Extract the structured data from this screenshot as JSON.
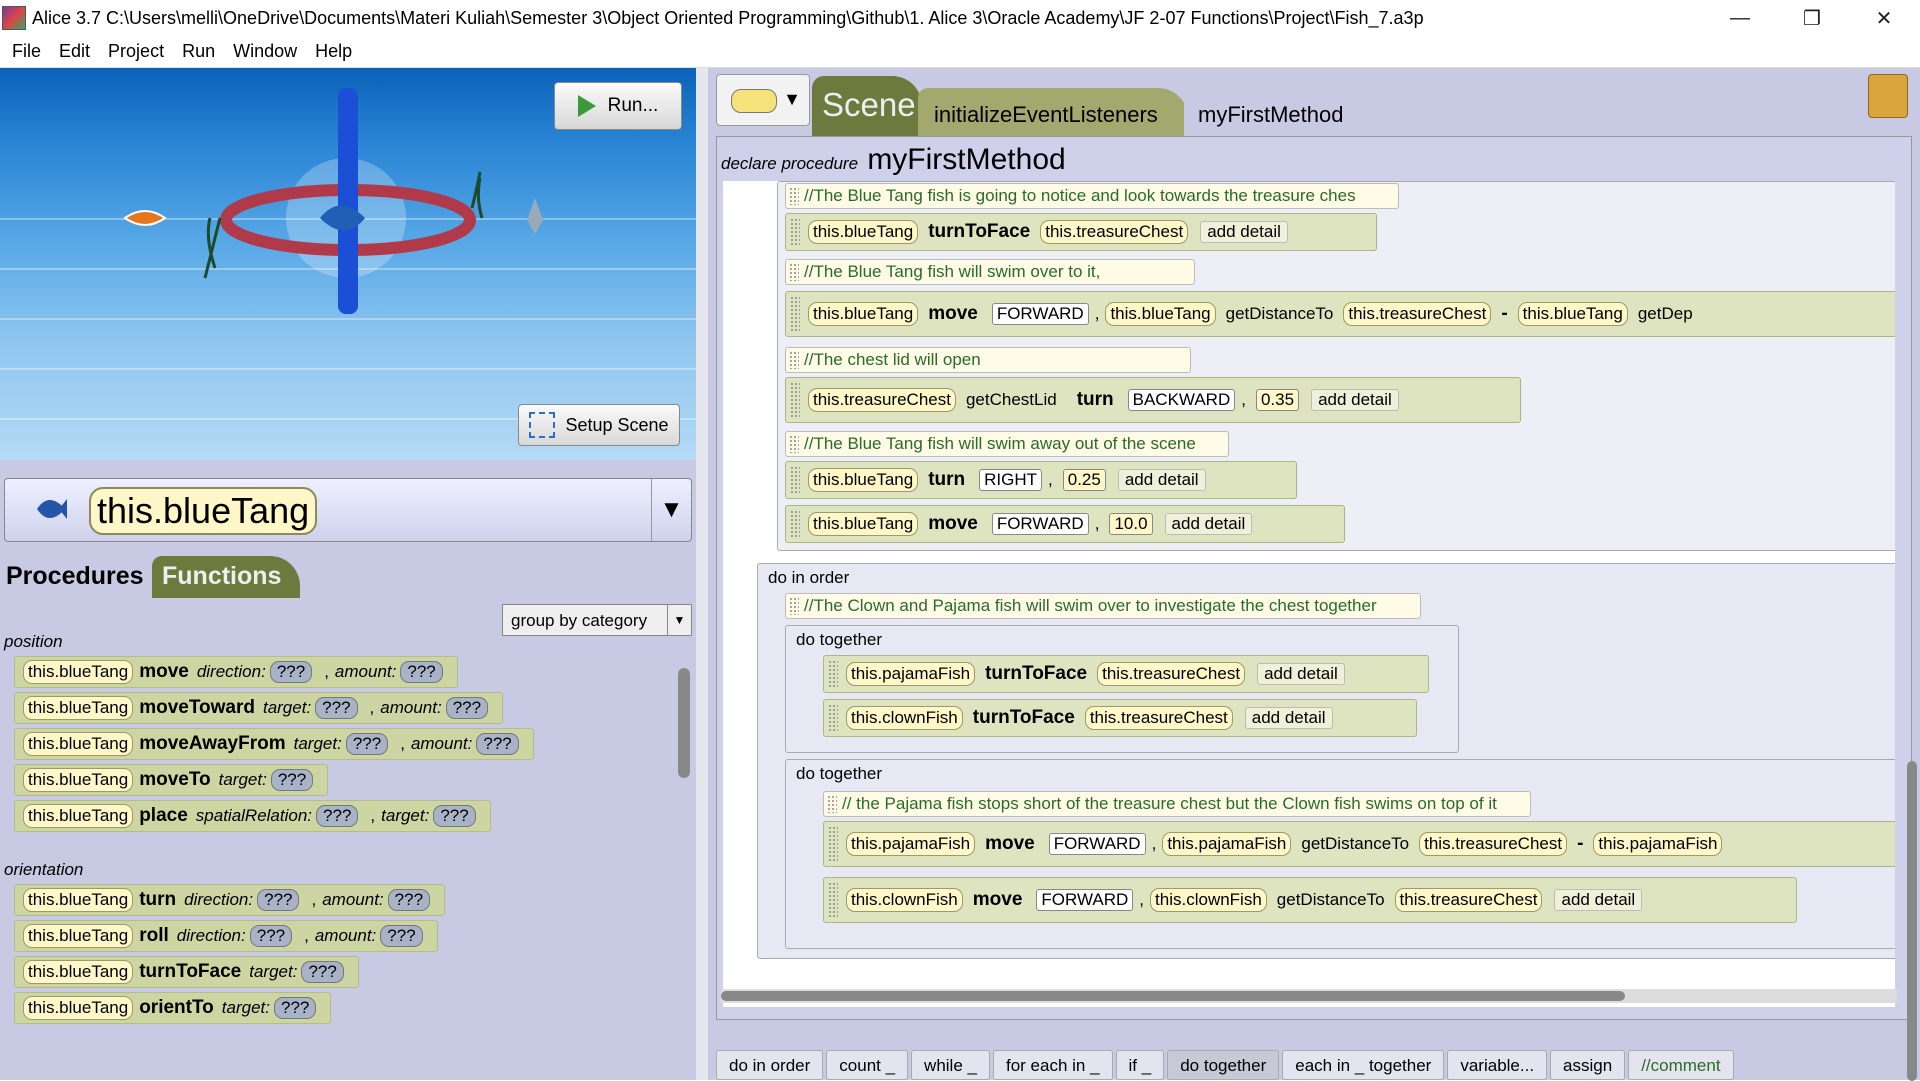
{
  "window": {
    "title": "Alice 3.7 C:\\Users\\melli\\OneDrive\\Documents\\Materi Kuliah\\Semester 3\\Object Oriented Programming\\Github\\1. Alice 3\\Oracle Academy\\JF 2-07 Functions\\Project\\Fish_7.a3p",
    "minimize": "—",
    "maximize": "❐",
    "close": "✕"
  },
  "menu": [
    "File",
    "Edit",
    "Project",
    "Run",
    "Window",
    "Help"
  ],
  "scene_view": {
    "run_label": "Run...",
    "setup_scene_label": "Setup Scene"
  },
  "object_selector": {
    "selected": "this.blueTang",
    "dropdown": "▼"
  },
  "palette": {
    "tabs": [
      "Procedures",
      "Functions"
    ],
    "group_by": "group by category",
    "categories": [
      {
        "name": "position",
        "rows": [
          {
            "obj": "this.blueTang",
            "method": "move",
            "params": [
              {
                "name": "direction:",
                "val": "???"
              },
              {
                "name": "amount:",
                "val": "???"
              }
            ]
          },
          {
            "obj": "this.blueTang",
            "method": "moveToward",
            "params": [
              {
                "name": "target:",
                "val": "???"
              },
              {
                "name": "amount:",
                "val": "???"
              }
            ]
          },
          {
            "obj": "this.blueTang",
            "method": "moveAwayFrom",
            "params": [
              {
                "name": "target:",
                "val": "???"
              },
              {
                "name": "amount:",
                "val": "???"
              }
            ]
          },
          {
            "obj": "this.blueTang",
            "method": "moveTo",
            "params": [
              {
                "name": "target:",
                "val": "???"
              }
            ]
          },
          {
            "obj": "this.blueTang",
            "method": "place",
            "params": [
              {
                "name": "spatialRelation:",
                "val": "???"
              },
              {
                "name": "target:",
                "val": "???"
              }
            ]
          }
        ]
      },
      {
        "name": "orientation",
        "rows": [
          {
            "obj": "this.blueTang",
            "method": "turn",
            "params": [
              {
                "name": "direction:",
                "val": "???"
              },
              {
                "name": "amount:",
                "val": "???"
              }
            ]
          },
          {
            "obj": "this.blueTang",
            "method": "roll",
            "params": [
              {
                "name": "direction:",
                "val": "???"
              },
              {
                "name": "amount:",
                "val": "???"
              }
            ]
          },
          {
            "obj": "this.blueTang",
            "method": "turnToFace",
            "params": [
              {
                "name": "target:",
                "val": "???"
              }
            ]
          },
          {
            "obj": "this.blueTang",
            "method": "orientTo",
            "params": [
              {
                "name": "target:",
                "val": "???"
              }
            ]
          }
        ]
      }
    ]
  },
  "editor": {
    "tabs": {
      "scene": "Scene",
      "listeners": "initializeEventListeners",
      "method": "myFirstMethod"
    },
    "declare_prefix": "declare procedure",
    "declare_name": "myFirstMethod",
    "comments": {
      "c1": "//The Blue Tang fish is going to notice and look towards the treasure ches",
      "c2": "//The Blue Tang fish will swim over to it,",
      "c3": "//The chest lid will open",
      "c4": "//The Blue Tang fish will swim away out of the scene",
      "c5": "//The Clown and Pajama fish will swim over to investigate the chest together",
      "c6": "// the Pajama fish stops short of the treasure chest but the Clown fish swims on top of it"
    },
    "tokens": {
      "blueTang": "this.blueTang",
      "treasureChest": "this.treasureChest",
      "pajamaFish": "this.pajamaFish",
      "clownFish": "this.clownFish",
      "turnToFace": "turnToFace",
      "move": "move",
      "turn": "turn",
      "getDistanceTo": "getDistanceTo",
      "getChestLid": "getChestLid",
      "getDep": "getDep",
      "forward": "FORWARD",
      "backward": "BACKWARD",
      "right": "RIGHT",
      "n035": "0.35",
      "n025": "0.25",
      "n100": "10.0",
      "add_detail": "add detail",
      "minus": "-",
      "comma": ",",
      "do_in_order": "do in order",
      "do_together": "do together"
    }
  },
  "bottom_bar": [
    "do in order",
    "count _",
    "while _",
    "for each in _",
    "if _",
    "do together",
    "each in _ together",
    "variable...",
    "assign",
    "//comment"
  ]
}
